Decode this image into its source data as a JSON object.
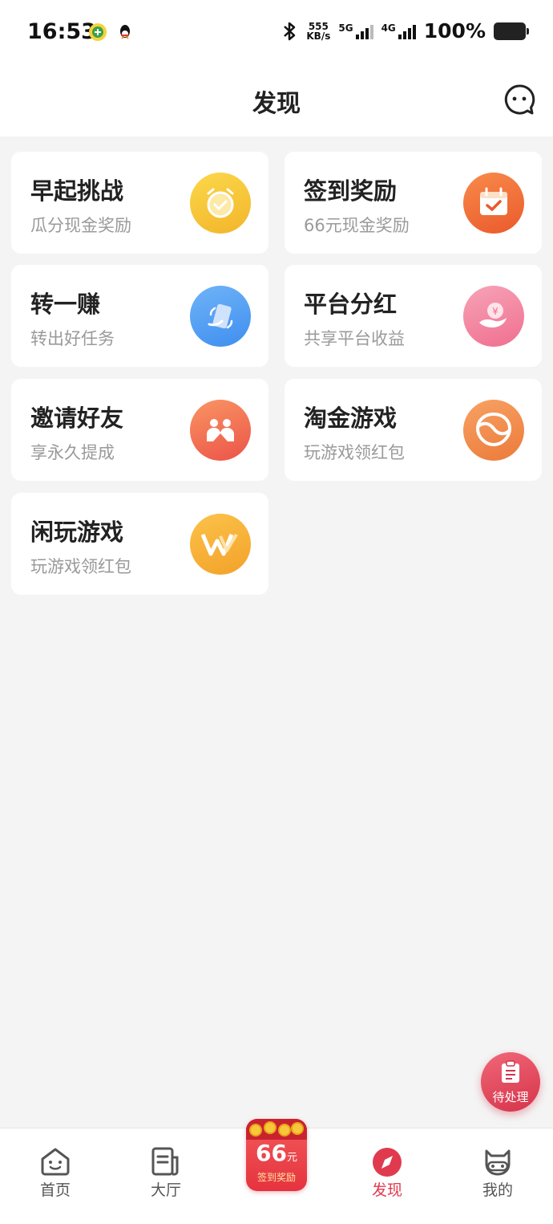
{
  "status_bar": {
    "time": "16:53",
    "speed_value": "555",
    "speed_unit": "KB/s",
    "net1": "5G",
    "net2": "4G",
    "battery": "100%"
  },
  "header": {
    "title": "发现",
    "message_icon": "chat-bubble-icon"
  },
  "cards": [
    {
      "title": "早起挑战",
      "subtitle": "瓜分现金奖励",
      "icon": "alarm-clock-icon"
    },
    {
      "title": "签到奖励",
      "subtitle": "66元现金奖励",
      "icon": "calendar-check-icon"
    },
    {
      "title": "转一赚",
      "subtitle": "转出好任务",
      "icon": "phone-share-icon"
    },
    {
      "title": "平台分红",
      "subtitle": "共享平台收益",
      "icon": "hand-coin-icon"
    },
    {
      "title": "邀请好友",
      "subtitle": "享永久提成",
      "icon": "two-people-icon"
    },
    {
      "title": "淘金游戏",
      "subtitle": "玩游戏领红包",
      "icon": "gold-bag-icon"
    },
    {
      "title": "闲玩游戏",
      "subtitle": "玩游戏领红包",
      "icon": "w-logo-icon"
    }
  ],
  "fab": {
    "label": "待处理",
    "icon": "clipboard-icon"
  },
  "tabbar": {
    "home": "首页",
    "hall": "大厅",
    "promo_amount": "66",
    "promo_unit": "元",
    "promo_text": "签到奖励",
    "discover": "发现",
    "mine": "我的",
    "active_tab": "发现"
  },
  "colors": {
    "accent": "#e03a4e",
    "background": "#f4f4f4"
  }
}
